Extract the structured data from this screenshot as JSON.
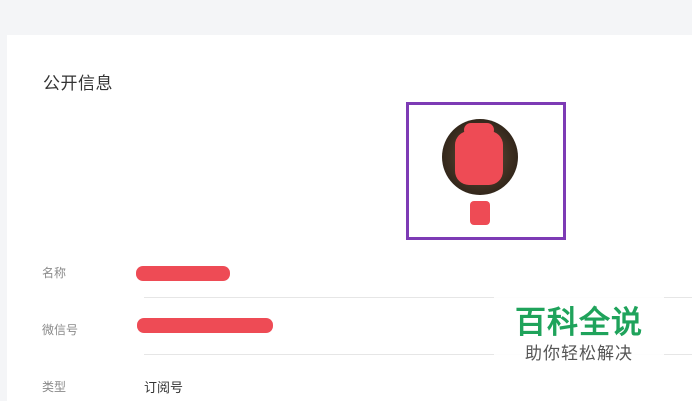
{
  "section": {
    "title": "公开信息"
  },
  "profile": {
    "avatar_icon": "account-avatar",
    "rows": [
      {
        "label": "名称",
        "value": ""
      },
      {
        "label": "微信号",
        "value": ""
      },
      {
        "label": "类型",
        "value": "订阅号"
      }
    ]
  },
  "watermark": {
    "main": "百科全说",
    "sub": "助你轻松解决"
  },
  "colors": {
    "highlight_border": "#7d3bb5",
    "redaction": "#ee4b55",
    "watermark_green": "#1fa35b"
  }
}
